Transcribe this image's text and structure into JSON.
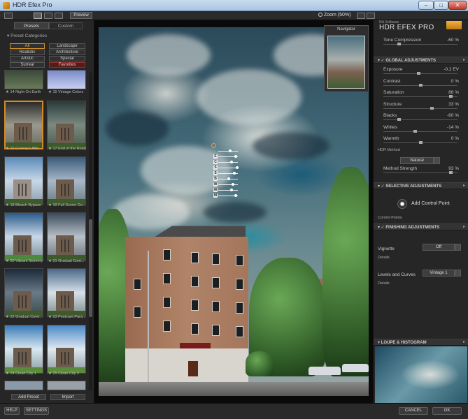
{
  "window": {
    "title": "HDR Efex Pro",
    "min": "–",
    "max": "□",
    "close": "✕"
  },
  "toolbar": {
    "preview_label": "Preview",
    "zoom_label": "Zoom (50%)"
  },
  "left": {
    "tabs": [
      "Presets",
      "Custom"
    ],
    "categories_title": "Preset Categories",
    "categories": [
      "All",
      "Landscape",
      "Realistic",
      "Architecture",
      "Artistic",
      "Special",
      "Surreal",
      "Favorites"
    ],
    "presets": [
      {
        "label": "★ 14 Night On Earth"
      },
      {
        "label": "★ 15 Vintage Colors"
      },
      {
        "label": "★ 16 Granny's Attic"
      },
      {
        "label": "★ 17 End of the Road"
      },
      {
        "label": "★ 18 Bleach Bypass"
      },
      {
        "label": "★ 19 Full Scene Co..."
      },
      {
        "label": "★ 20 Vibrant Scenery"
      },
      {
        "label": "★ 21 Gradual Cont..."
      },
      {
        "label": "★ 22 Gradual Contr..."
      },
      {
        "label": "★ 23 Postcard Para..."
      },
      {
        "label": "★ 24 Clean City 1"
      },
      {
        "label": "★ 25 Clean City 2"
      }
    ],
    "add_preset": "Add Preset",
    "import": "Import"
  },
  "navigator": {
    "title": "Navigator"
  },
  "right": {
    "brand_small": "Nik Software",
    "brand_title": "HDR EFEX PRO",
    "tone_compression": {
      "label": "Tone Compression",
      "value": "-60 %",
      "level": 0.2
    },
    "global_title": "GLOBAL ADJUSTMENTS",
    "global": [
      {
        "label": "Exposure",
        "value": "-0.2 EV",
        "level": 0.48
      },
      {
        "label": "Contrast",
        "value": "0 %",
        "level": 0.5
      },
      {
        "label": "Saturation",
        "value": "86 %",
        "level": 0.93
      },
      {
        "label": "Structure",
        "value": "33 %",
        "level": 0.66
      },
      {
        "label": "Blacks",
        "value": "-60 %",
        "level": 0.2
      },
      {
        "label": "Whites",
        "value": "-14 %",
        "level": 0.43
      },
      {
        "label": "Warmth",
        "value": "0 %",
        "level": 0.5
      }
    ],
    "hdr_method_label": "HDR Method",
    "hdr_method_value": "Natural",
    "method_strength": {
      "label": "Method Strength",
      "value": "93 %",
      "level": 0.93
    },
    "selective_title": "SELECTIVE ADJUSTMENTS",
    "add_control_point": "Add Control Point",
    "control_points": "Control Points",
    "finishing_title": "FINISHING ADJUSTMENTS",
    "vignette_label": "Vignette",
    "vignette_value": "Off",
    "details_1": "Details",
    "levels_label": "Levels and Curves",
    "levels_value": "Vintage 1",
    "details_2": "Details",
    "loupe_title": "LOUPE & HISTOGRAM"
  },
  "bottom": {
    "help": "HELP",
    "settings": "SETTINGS",
    "cancel": "CANCEL",
    "ok": "OK"
  }
}
